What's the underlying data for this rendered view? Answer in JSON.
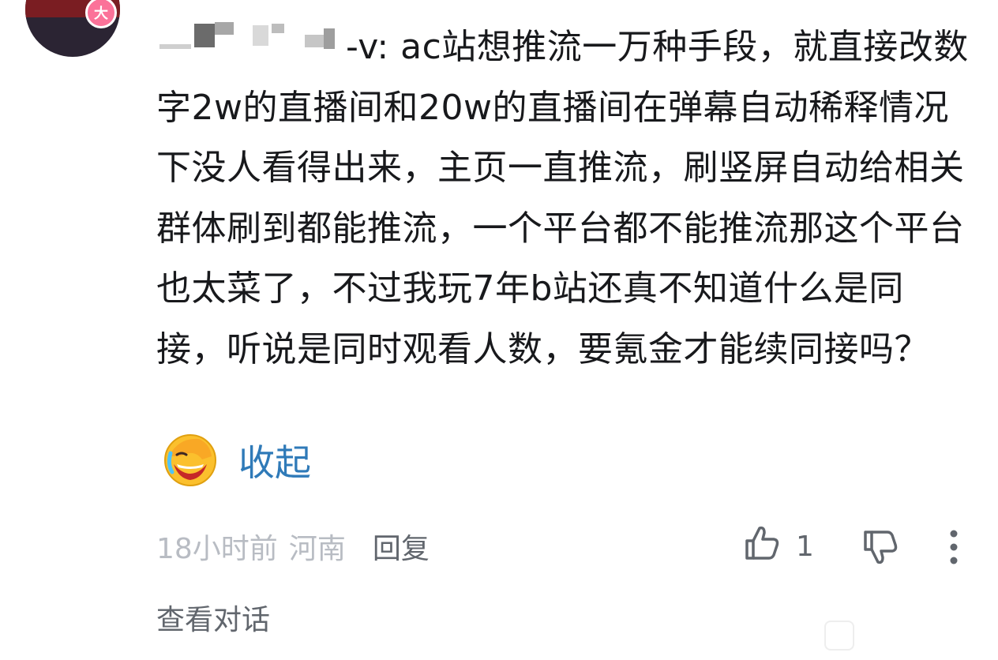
{
  "comment": {
    "avatar_badge": "大",
    "username_visible": "-v",
    "username_separator": ": ",
    "body": "ac站想推流一万种手段，就直接改数字2w的直播间和20w的直播间在弹幕自动稀释情况下没人看得出来，主页一直推流，刷竖屏自动给相关群体刷到都能推流，一个平台都不能推流那这个平台也太菜了，不过我玩7年b站还真不知道什么是同接，听说是同时观看人数，要氪金才能续同接吗？",
    "collapse_label": "收起",
    "emoji_icon": "laughing-crying-emoji-icon"
  },
  "meta": {
    "time": "18小时前",
    "location": "河南",
    "reply_label": "回复",
    "like_count": "1"
  },
  "footer": {
    "view_conversation_label": "查看对话"
  },
  "colors": {
    "text": "#18191c",
    "link": "#2f7ab8",
    "muted": "#b8bcc3",
    "icon": "#61666d",
    "badge": "#fb7299"
  }
}
